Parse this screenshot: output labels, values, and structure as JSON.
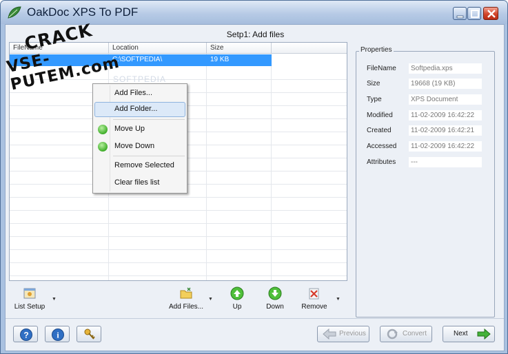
{
  "window": {
    "title": "OakDoc XPS To PDF"
  },
  "step_title": "Setp1: Add files",
  "list": {
    "columns": [
      "FileName",
      "Location",
      "Size"
    ],
    "rows": [
      {
        "filename": "",
        "location": "C:\\SOFTPEDIA\\",
        "size": "19 KB"
      }
    ],
    "background_watermark": "SOFTPEDIA"
  },
  "context_menu": {
    "items": [
      "Add Files...",
      "Add Folder...",
      "Move Up",
      "Move Down",
      "Remove Selected",
      "Clear files list"
    ],
    "hover": "Add Folder..."
  },
  "toolbar": {
    "list_setup": "List Setup",
    "add_files": "Add Files...",
    "up": "Up",
    "down": "Down",
    "remove": "Remove"
  },
  "properties": {
    "legend": "Properties",
    "rows": [
      {
        "key": "FileName",
        "value": "Softpedia.xps"
      },
      {
        "key": "Size",
        "value": "19668 (19 KB)"
      },
      {
        "key": "Type",
        "value": "XPS Document"
      },
      {
        "key": "Modified",
        "value": "11-02-2009 16:42:22"
      },
      {
        "key": "Created",
        "value": "11-02-2009 16:42:21"
      },
      {
        "key": "Accessed",
        "value": "11-02-2009 16:42:22"
      },
      {
        "key": "Attributes",
        "value": "---"
      }
    ]
  },
  "nav": {
    "previous": "Previous",
    "convert": "Convert",
    "next": "Next"
  },
  "watermark": {
    "line1": "CRACK",
    "line2": "VSE-PUTEM.com"
  },
  "colors": {
    "selection": "#3399ff",
    "accent_green": "#3fae2a",
    "close_red": "#d2452a"
  },
  "icons": [
    "leaf-icon",
    "minimize-icon",
    "maximize-icon",
    "close-icon",
    "help-icon",
    "info-icon",
    "key-icon",
    "arrow-left-icon",
    "convert-icon",
    "arrow-right-icon",
    "green-circle-icon",
    "folder-icon",
    "remove-x-icon"
  ]
}
